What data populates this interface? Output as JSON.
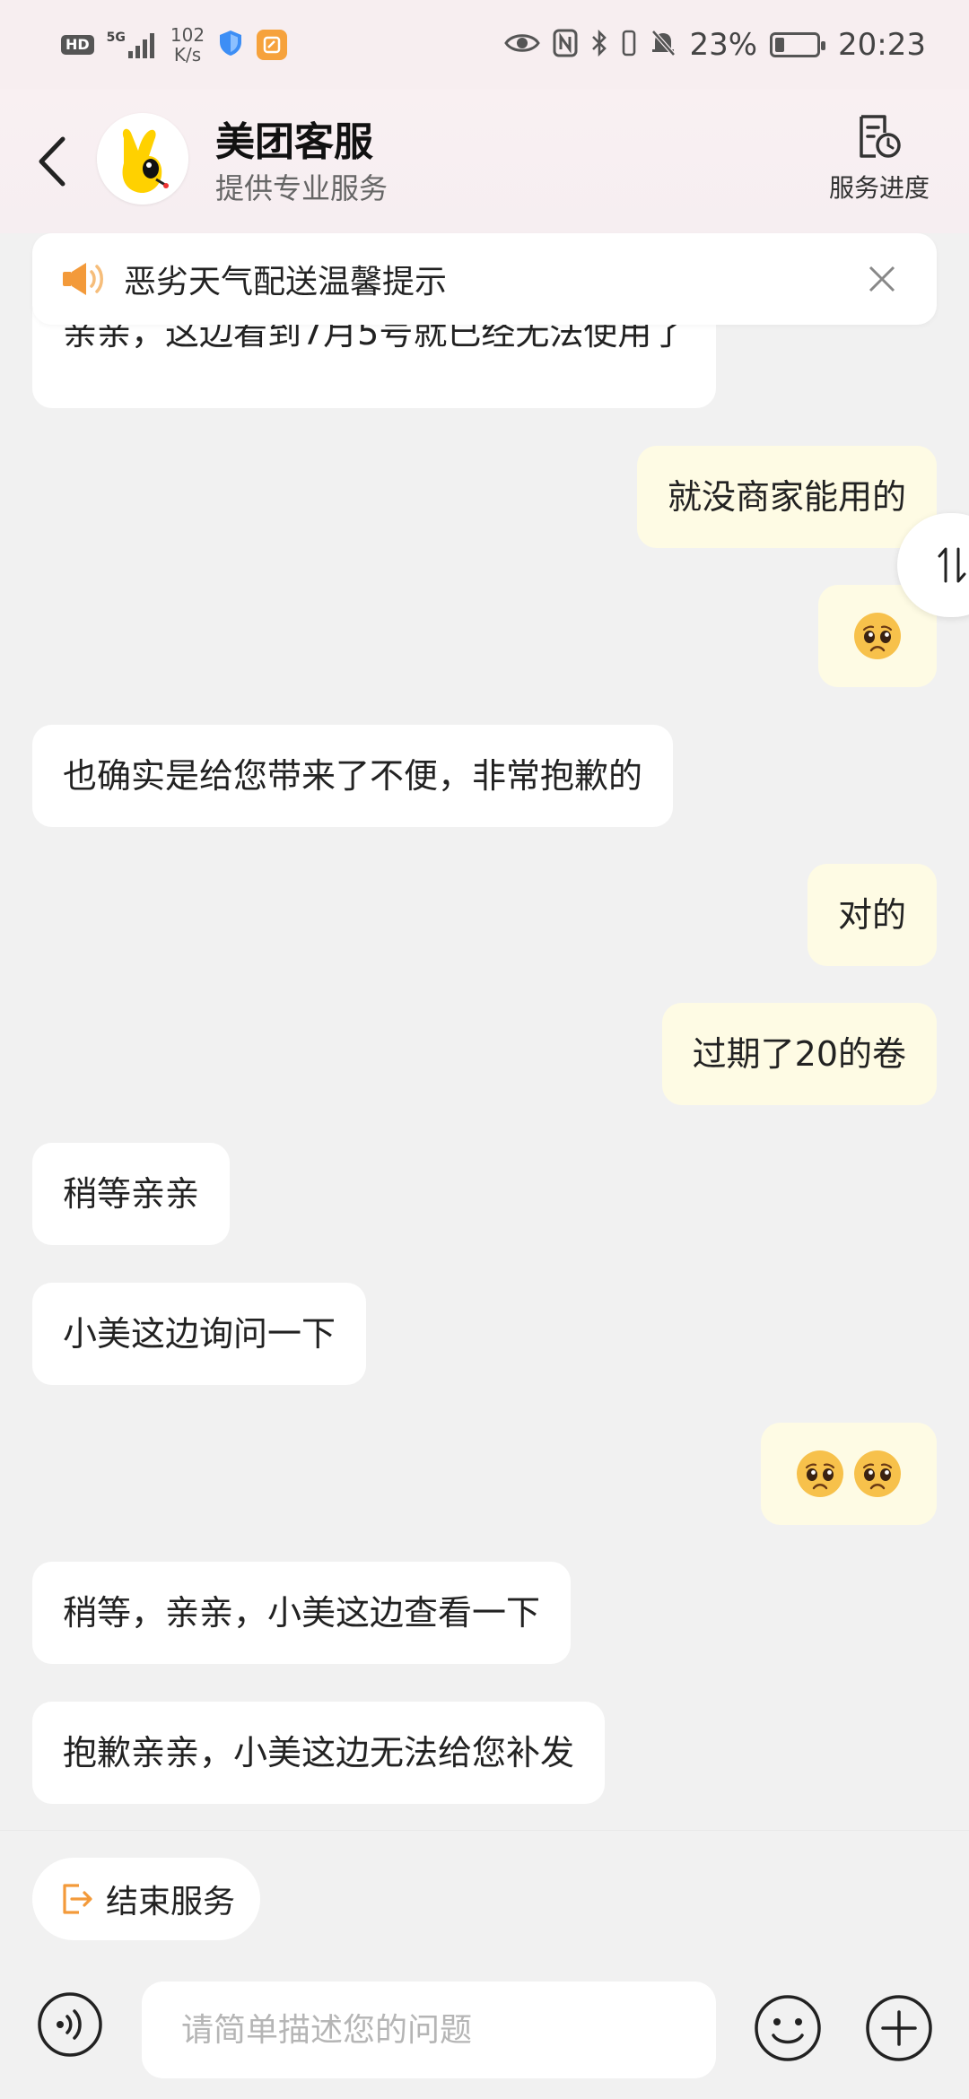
{
  "status_bar": {
    "hd": "HD",
    "net": "5G",
    "speed_top": "102",
    "speed_bottom": "K/s",
    "battery_percent": "23%",
    "battery_level": 0.23,
    "time": "20:23"
  },
  "header": {
    "title": "美团客服",
    "subtitle": "提供专业服务",
    "progress_label": "服务进度"
  },
  "notice": {
    "text": "恶劣天气配送温馨提示"
  },
  "messages": [
    {
      "side": "in",
      "text": "亲亲，这边看到7月5号就已经无法使用了"
    },
    {
      "side": "out",
      "text": "就没商家能用的"
    },
    {
      "side": "out",
      "emoji": [
        "pleading-face"
      ]
    },
    {
      "side": "in",
      "text": "也确实是给您带来了不便，非常抱歉的"
    },
    {
      "side": "out",
      "text": "对的"
    },
    {
      "side": "out",
      "text": "过期了20的卷"
    },
    {
      "side": "in",
      "text": "稍等亲亲"
    },
    {
      "side": "in",
      "text": "小美这边询问一下"
    },
    {
      "side": "out",
      "emoji": [
        "pleading-face",
        "pleading-face"
      ]
    },
    {
      "side": "in",
      "text": "稍等，亲亲，小美这边查看一下"
    },
    {
      "side": "in",
      "text": "抱歉亲亲，小美这边无法给您补发"
    }
  ],
  "bottom": {
    "end_service_label": "结束服务",
    "input_placeholder": "请简单描述您的问题"
  },
  "colors": {
    "out_bubble": "#fefbe4",
    "in_bubble": "#ffffff",
    "accent_orange": "#f39a3a",
    "background": "#f1f1f1"
  }
}
